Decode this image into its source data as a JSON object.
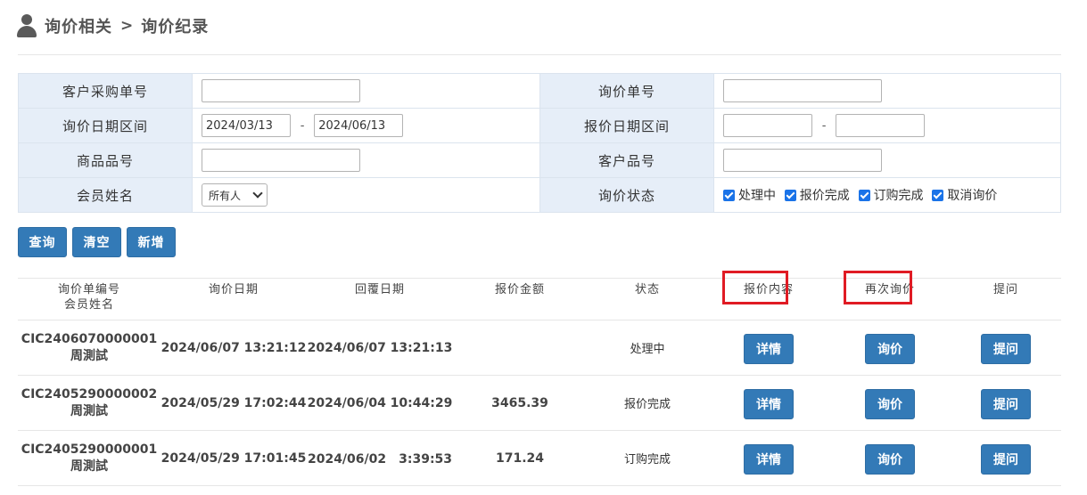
{
  "breadcrumb": {
    "root": "询价相关",
    "separator": ">",
    "current": "询价纪录"
  },
  "search": {
    "rows": [
      {
        "label1": "客户采购单号",
        "label2": "询价单号"
      },
      {
        "label1": "询价日期区间",
        "label2": "报价日期区间"
      },
      {
        "label1": "商品品号",
        "label2": "客户品号"
      },
      {
        "label1": "会员姓名",
        "label2": "询价状态"
      }
    ],
    "inquiry_date_from": "2024/03/13",
    "inquiry_date_to": "2024/06/13",
    "date_dash": "-",
    "member_select": "所有人",
    "status_options": [
      "处理中",
      "报价完成",
      "订购完成",
      "取消询价"
    ]
  },
  "buttons": {
    "query": "查询",
    "clear": "清空",
    "add": "新增"
  },
  "table": {
    "headers": {
      "no_line1": "询价单编号",
      "no_line2": "会员姓名",
      "inquiry_date": "询价日期",
      "reply_date": "回覆日期",
      "amount": "报价金额",
      "status": "状态",
      "quote": "报价内容",
      "reinquiry": "再次询价",
      "question": "提问"
    },
    "rows": [
      {
        "no": "CIC2406070000001",
        "member": "周測試",
        "inquiry_date": "2024/06/07 13:21:12",
        "reply_date": "2024/06/07 13:21:13",
        "amount": "",
        "status": "处理中"
      },
      {
        "no": "CIC2405290000002",
        "member": "周測試",
        "inquiry_date": "2024/05/29 17:02:44",
        "reply_date": "2024/06/04 10:44:29",
        "amount": "3465.39",
        "status": "报价完成"
      },
      {
        "no": "CIC2405290000001",
        "member": "周測試",
        "inquiry_date": "2024/05/29 17:01:45",
        "reply_date": "2024/06/02　3:39:53",
        "amount": "171.24",
        "status": "订购完成"
      }
    ],
    "action_labels": {
      "detail": "详情",
      "reinquire": "询价",
      "ask": "提问"
    }
  },
  "colors": {
    "primary": "#337ab7",
    "label_bg": "#e6eef8",
    "highlight": "#e01b24"
  }
}
